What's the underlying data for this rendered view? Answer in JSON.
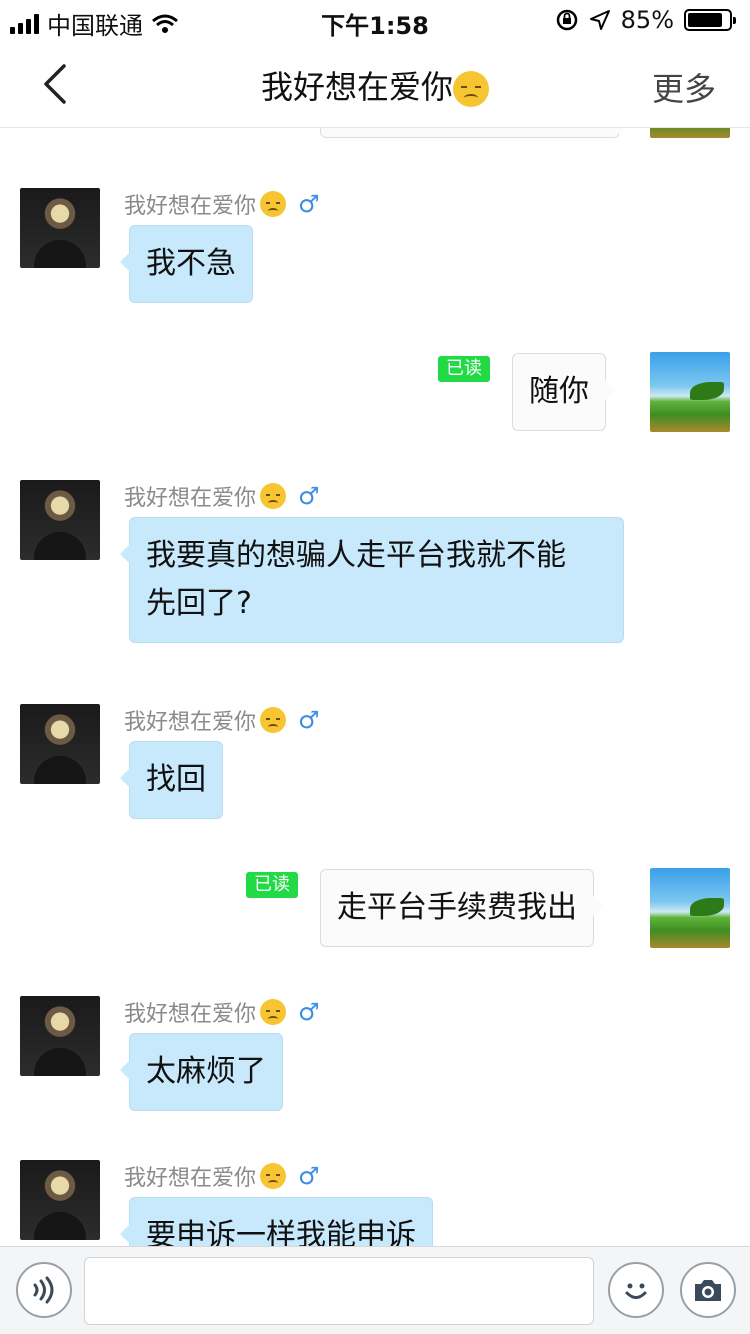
{
  "status_bar": {
    "carrier": "中国联通",
    "time": "下午1:58",
    "battery_text": "85%",
    "battery_level": 0.85,
    "icons": [
      "signal-icon",
      "wifi-icon",
      "orientation-lock-icon",
      "location-arrow-icon",
      "battery-icon"
    ]
  },
  "nav": {
    "back_icon": "chevron-left-icon",
    "title": "我好想在爱你",
    "title_emoji": "disappointed-face-emoji",
    "more_label": "更多"
  },
  "messages": [
    {
      "from": "self",
      "text": "",
      "partial": true
    },
    {
      "from": "other",
      "sender": "我好想在爱你",
      "gender_symbol": "♂",
      "text": "我不急"
    },
    {
      "from": "self",
      "read_label": "已读",
      "text": "随你"
    },
    {
      "from": "other",
      "sender": "我好想在爱你",
      "gender_symbol": "♂",
      "text": "我要真的想骗人走平台我就不能\n先回了?"
    },
    {
      "from": "other",
      "sender": "我好想在爱你",
      "gender_symbol": "♂",
      "text": "找回"
    },
    {
      "from": "self",
      "read_label": "已读",
      "text": "走平台手续费我出"
    },
    {
      "from": "other",
      "sender": "我好想在爱你",
      "gender_symbol": "♂",
      "text": "太麻烦了"
    },
    {
      "from": "other",
      "sender": "我好想在爱你",
      "gender_symbol": "♂",
      "text": "要申诉一样我能申诉",
      "partial": true
    }
  ],
  "input_bar": {
    "voice_icon": "voice-icon",
    "text_value": "",
    "emoji_icon": "smiley-icon",
    "camera_icon": "camera-icon"
  },
  "colors": {
    "incoming_bubble": "#c8e9fb",
    "outgoing_bubble": "#fbfbfb",
    "read_badge": "#22d946",
    "gender_male": "#3a8ee6"
  }
}
